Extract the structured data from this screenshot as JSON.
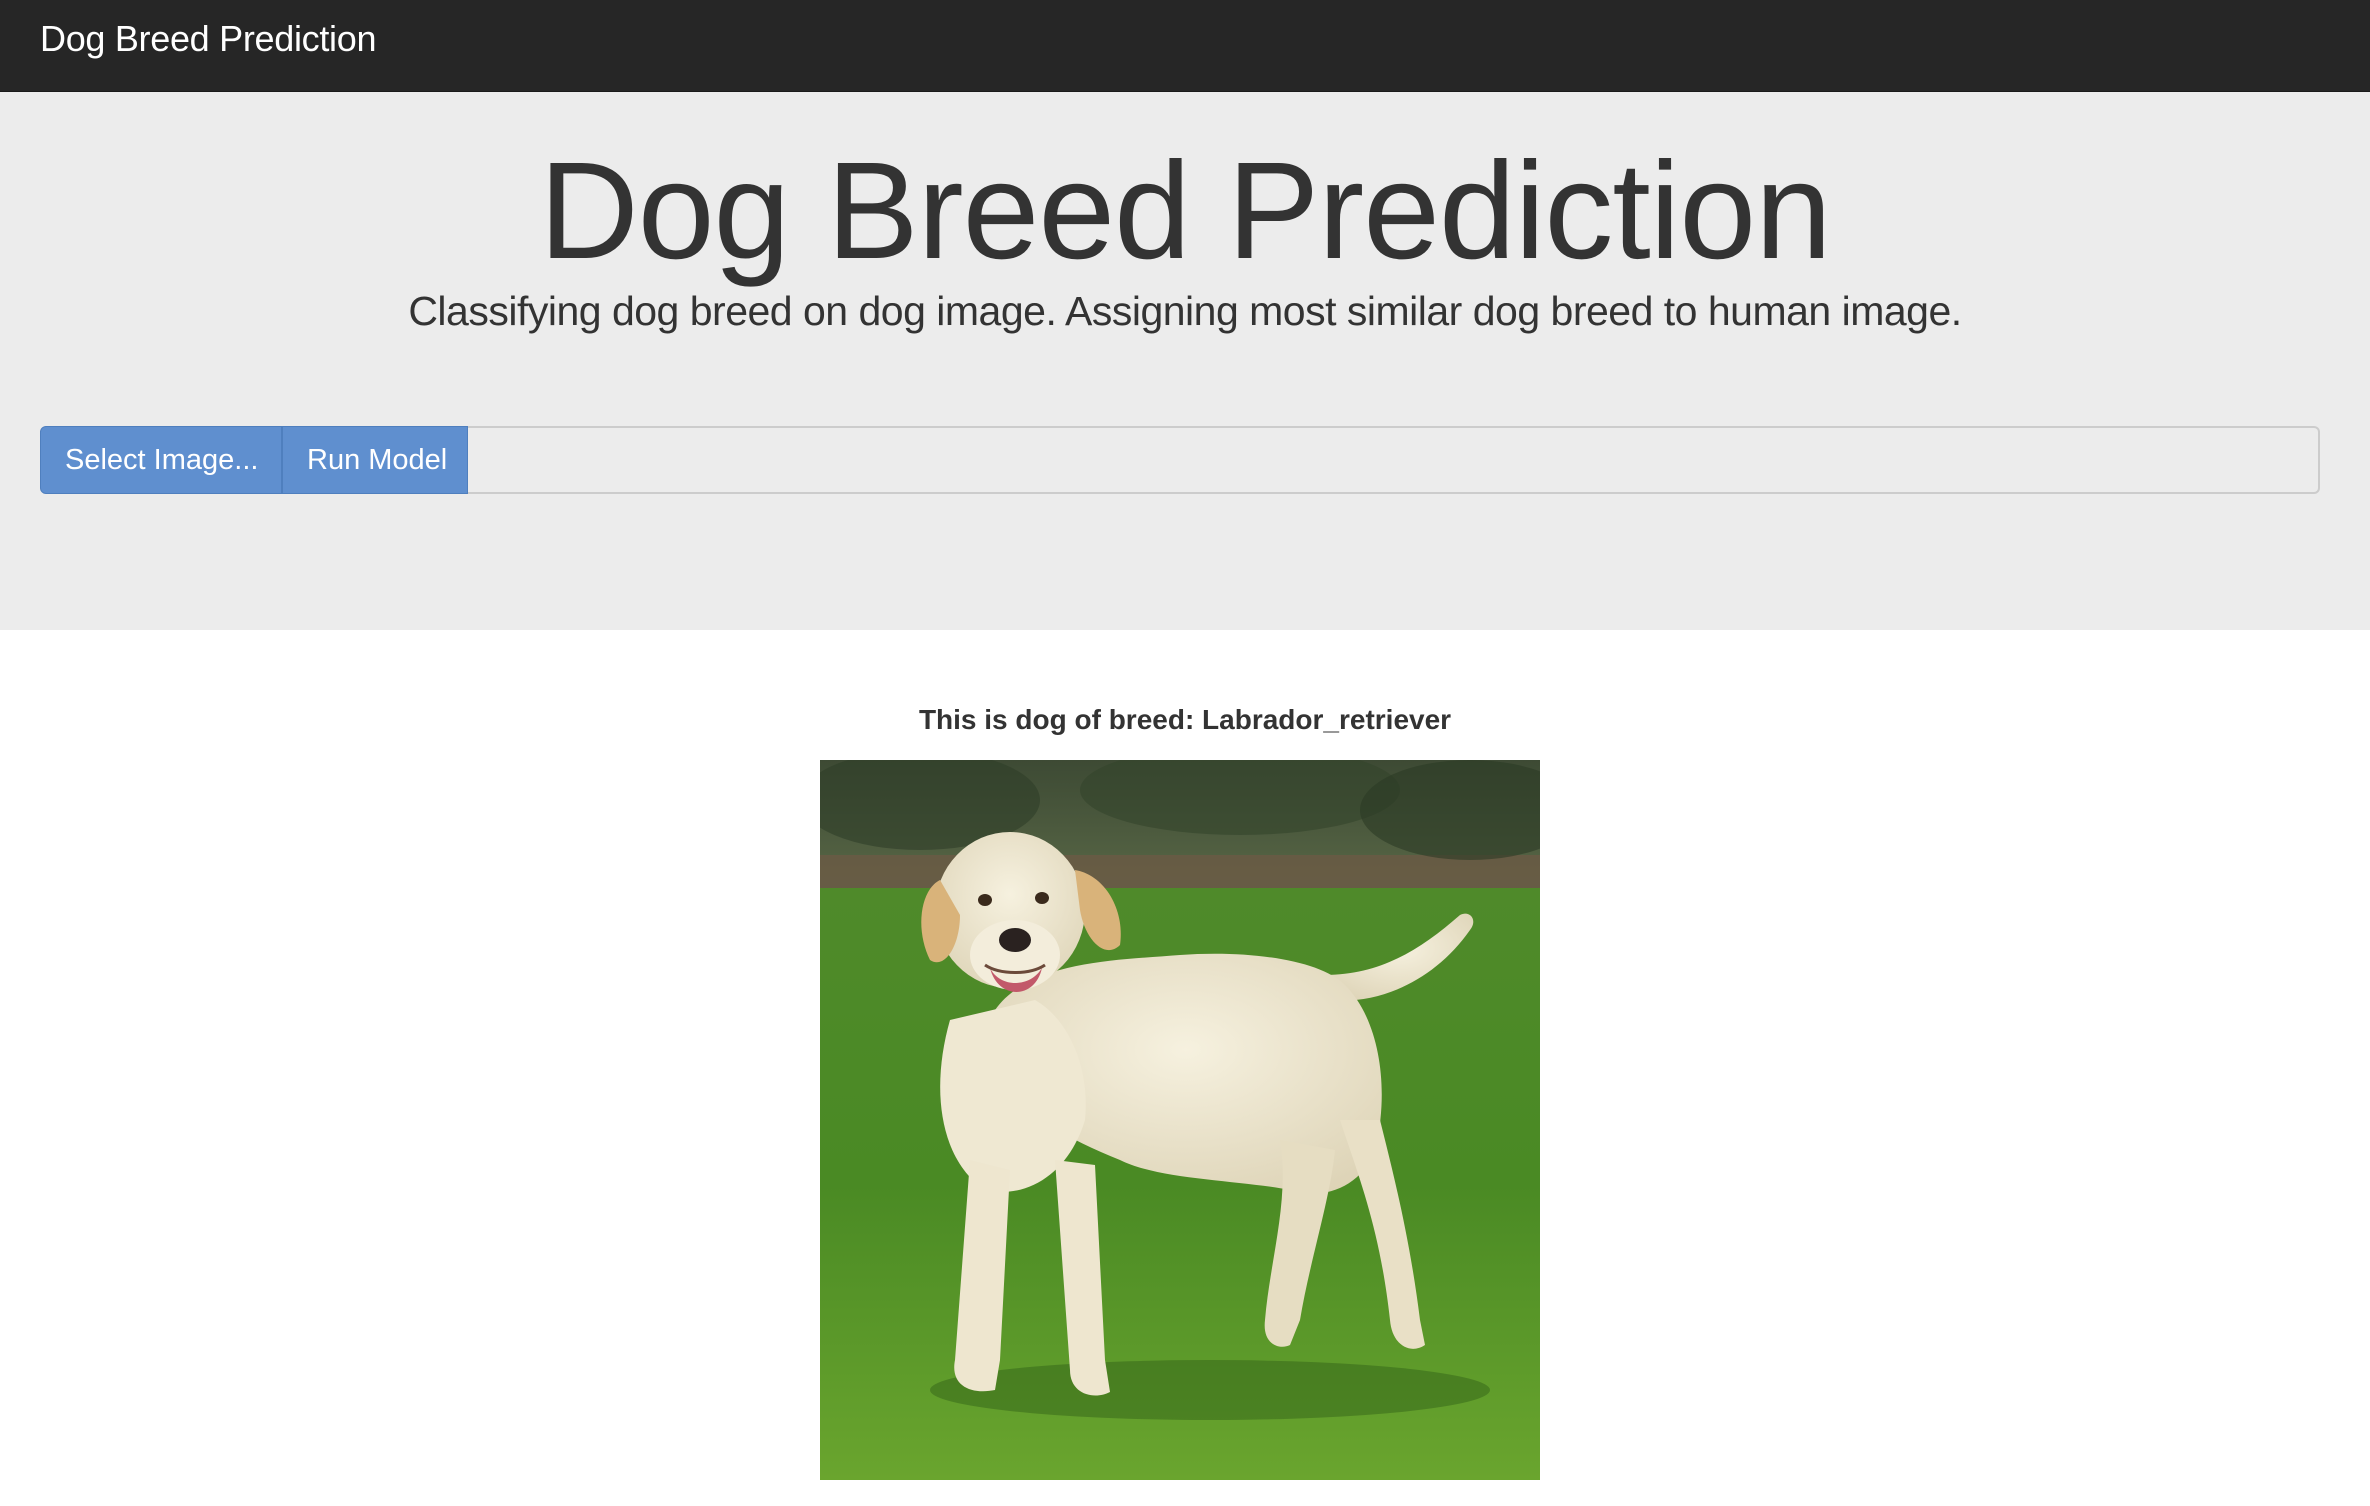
{
  "navbar": {
    "brand": "Dog Breed Prediction"
  },
  "jumbotron": {
    "title": "Dog Breed Prediction",
    "subtitle": "Classifying dog breed on dog image. Assigning most similar dog breed to human image."
  },
  "upload": {
    "select_label": "Select Image...",
    "run_label": "Run Model",
    "file_value": ""
  },
  "result": {
    "label": "This is dog of breed: Labrador_retriever"
  },
  "colors": {
    "navbar_bg": "#262626",
    "jumbotron_bg": "#ececec",
    "button_blue": "#5f8fcf",
    "text_dark": "#333333"
  }
}
